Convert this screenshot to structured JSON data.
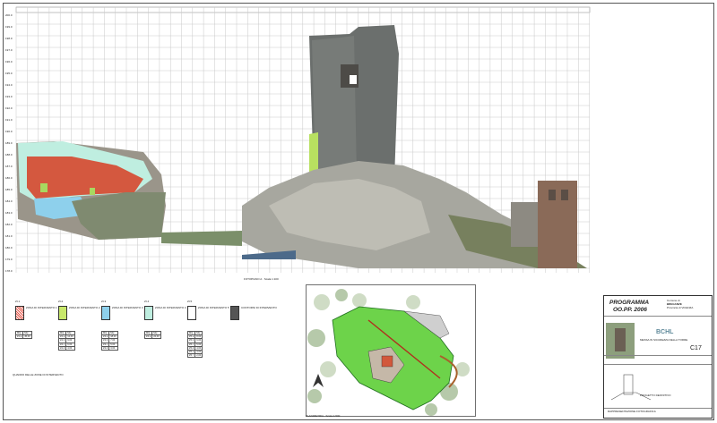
{
  "elevation": {
    "left_scale": [
      "200.0",
      "199.0",
      "198.0",
      "197.0",
      "196.0",
      "195.0",
      "194.0",
      "193.0",
      "192.0",
      "191.0",
      "190.0",
      "189.0",
      "188.0",
      "187.0",
      "186.0",
      "185.0",
      "184.0",
      "183.0",
      "182.0",
      "181.0",
      "180.0",
      "179.0",
      "178.0"
    ],
    "caption": "FOTOPIANO A · Scala 1:100"
  },
  "legend": {
    "title": "QUADRO DELLE ZONE DI INTERVENTO",
    "items": [
      {
        "code": "ZI.1",
        "label": "ZONA DI INTERVENTO 1",
        "color": "#e8584a",
        "rows": [
          [
            "MQ",
            "MQ"
          ],
          [
            "Z1 a",
            "45,00"
          ]
        ]
      },
      {
        "code": "ZI.2",
        "label": "ZONA DI INTERVENTO 2",
        "color": "#c8e86a",
        "rows": [
          [
            "MQ",
            "MQ"
          ],
          [
            "Z2 a",
            "12,00"
          ],
          [
            "Z2 b",
            "9,00"
          ],
          [
            "Z2 c",
            "6,00"
          ],
          [
            "Z2 d",
            "4,00"
          ]
        ]
      },
      {
        "code": "ZI.3",
        "label": "ZONA DI INTERVENTO 3",
        "color": "#8ed0ec",
        "rows": [
          [
            "MQ",
            "MQ"
          ],
          [
            "Z3 a",
            "18,00"
          ],
          [
            "Z3 b",
            "7,00"
          ],
          [
            "Z3 c",
            "5,00"
          ],
          [
            "Z3 d",
            "3,00"
          ]
        ]
      },
      {
        "code": "ZI.4",
        "label": "ZONA DI INTERVENTO 4",
        "color": "#bfeee0",
        "rows": [
          [
            "MQ",
            "MQ"
          ],
          [
            "Z4 a",
            "22,00"
          ]
        ]
      },
      {
        "code": "ZI.5",
        "label": "ZONA DI INTERVENTO 5",
        "color": "#ffffff",
        "rows": [
          [
            "MQ",
            "MQ"
          ],
          [
            "Z5 a",
            "8,00"
          ],
          [
            "Z5 b",
            "6,00"
          ],
          [
            "Z5 c",
            "5,00"
          ],
          [
            "Z5 d",
            "4,00"
          ],
          [
            "Z5 e",
            "3,00"
          ],
          [
            "Z5 f",
            "2,00"
          ]
        ]
      },
      {
        "code": "",
        "label": "CONTORNI DI INTERVENTO",
        "color": "#555555",
        "rows": []
      }
    ]
  },
  "site_plan": {
    "caption": "PLANIMETRIA · Scala 1:500"
  },
  "title_block": {
    "program": "PROGRAMMA",
    "program_sub": "OO.PP. 2006",
    "comune": "Comune di",
    "comune_name": "BREGANZE",
    "provincia": "Provincia di VICENZA",
    "sheet_code": "C17",
    "logo_text": "BCHL",
    "project": "MESSA IN SICUREZZA DELLA TORRE",
    "phase": "PROGETTO DEFINITIVO",
    "footer": "RAPPRESENTAZIONE FOTOGRAFICA"
  }
}
